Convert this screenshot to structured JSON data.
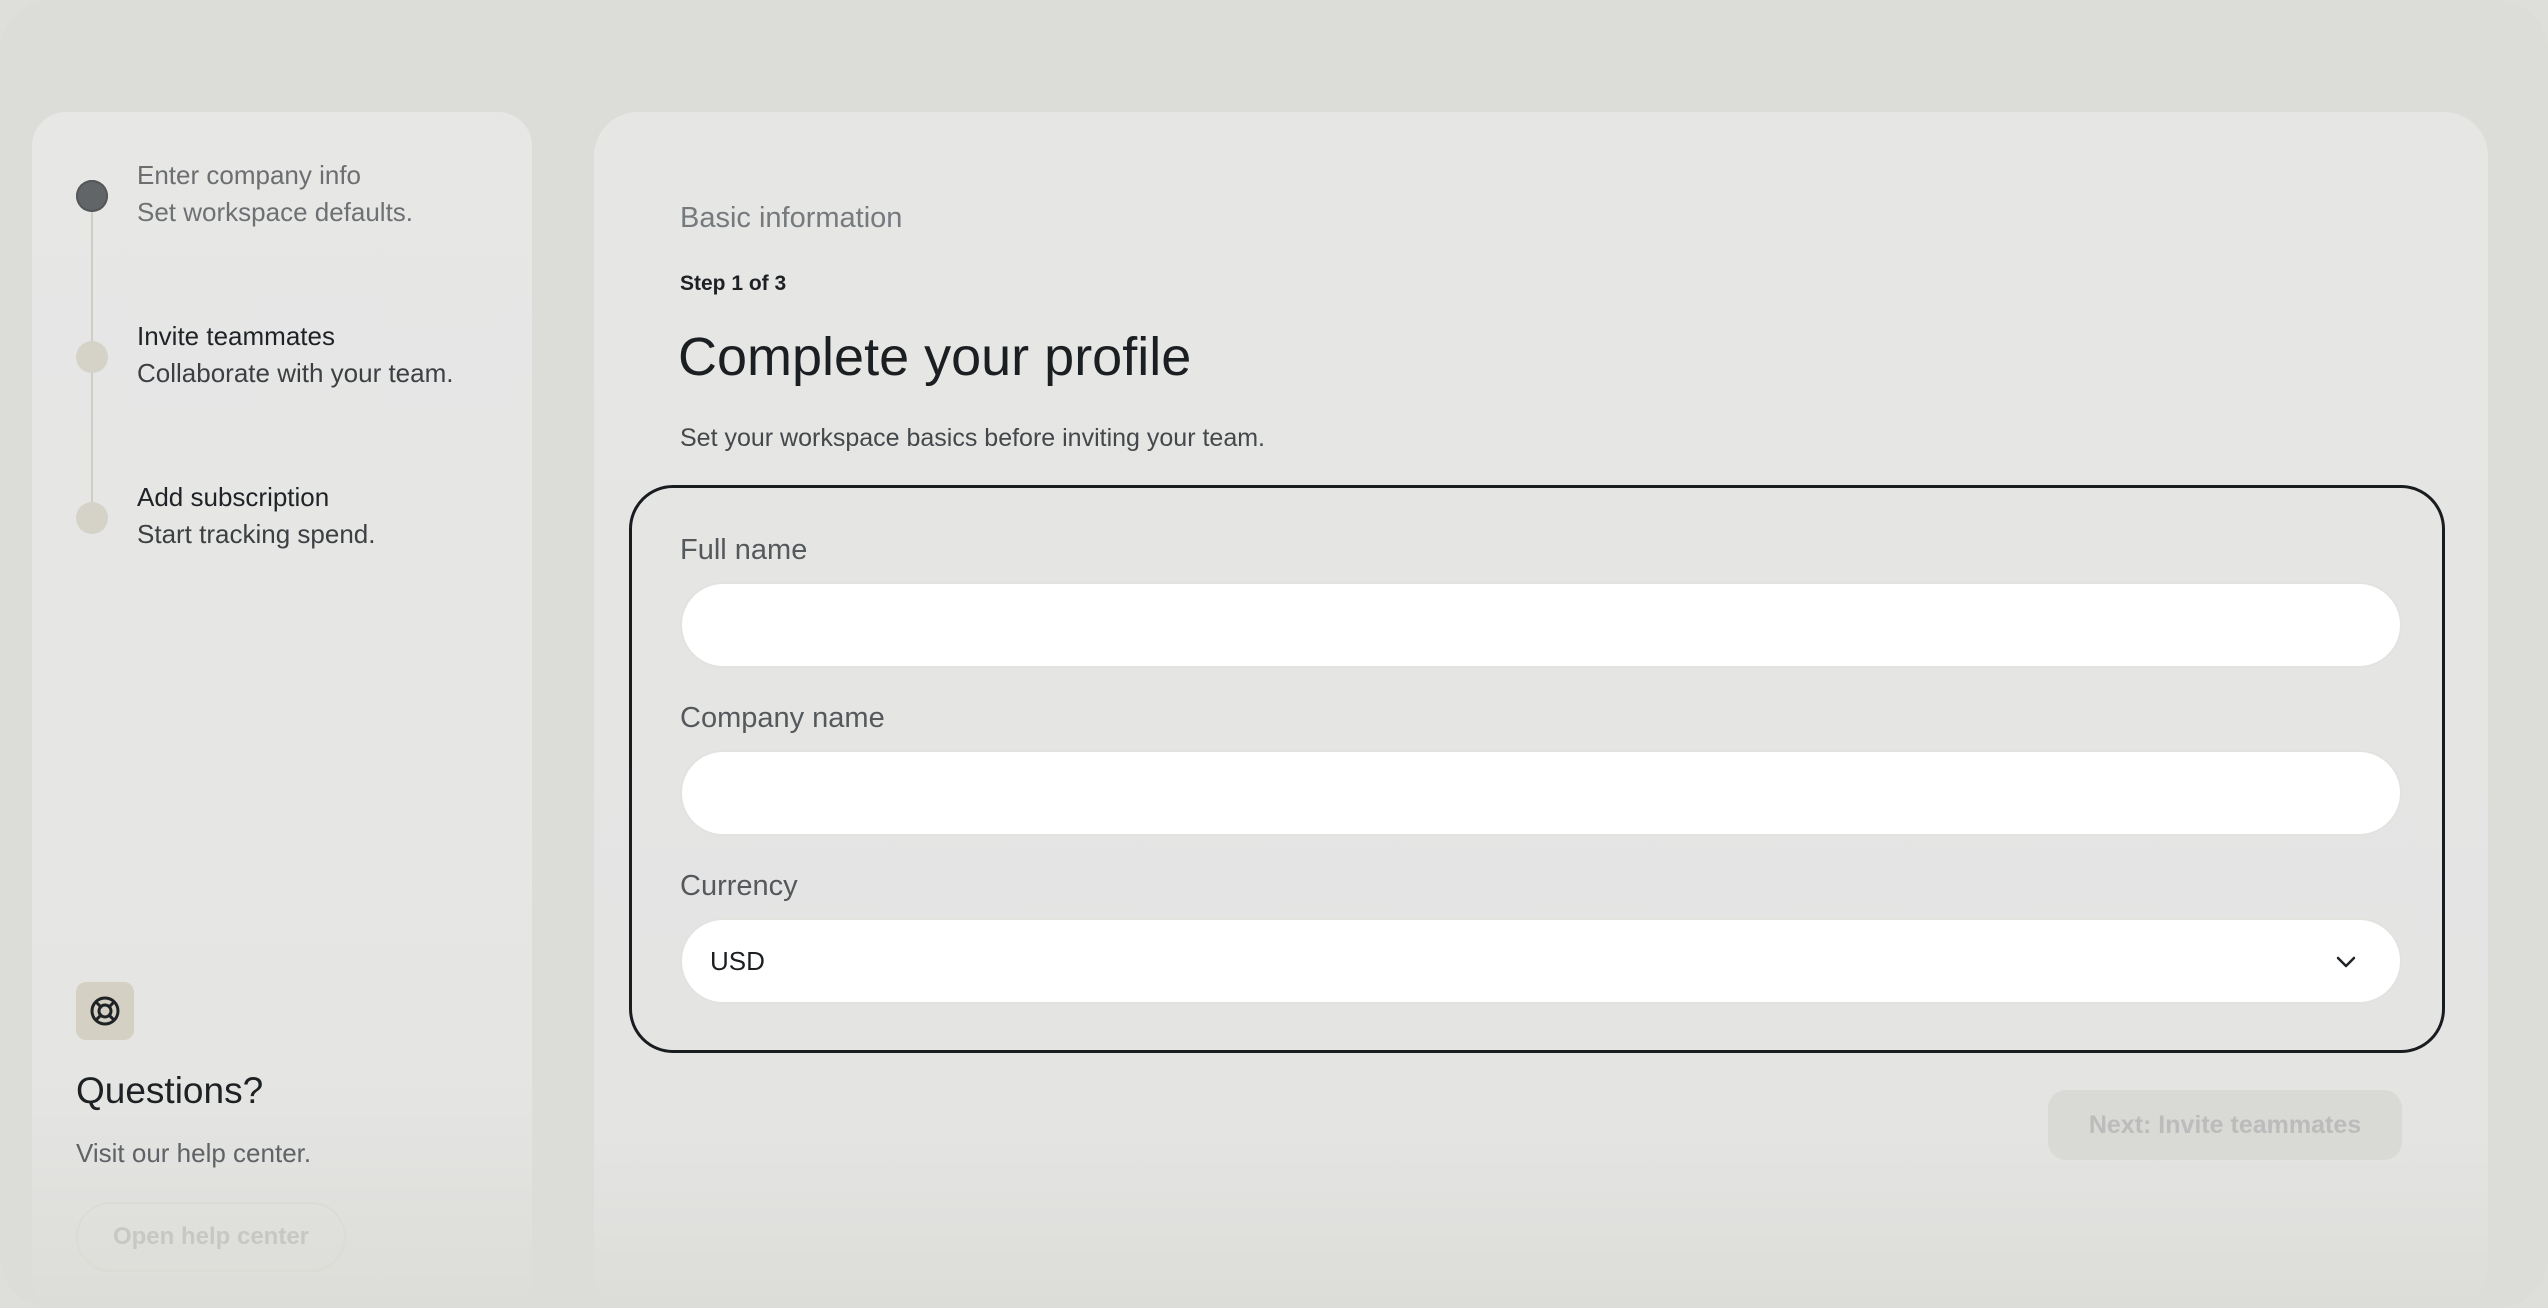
{
  "steps": [
    {
      "title": "Enter company info",
      "subtitle": "Set workspace defaults.",
      "state": "current"
    },
    {
      "title": "Invite teammates",
      "subtitle": "Collaborate with your team.",
      "state": "upcoming"
    },
    {
      "title": "Add subscription",
      "subtitle": "Start tracking spend.",
      "state": "upcoming"
    }
  ],
  "help": {
    "icon": "lifebuoy-icon",
    "title": "Questions?",
    "subtitle": "Visit our help center.",
    "button_label": "Open help center"
  },
  "main": {
    "section_label": "Basic information",
    "step_counter": "Step 1 of 3",
    "title": "Complete your profile",
    "subtitle": "Set your workspace basics before inviting your team."
  },
  "form": {
    "full_name": {
      "label": "Full name",
      "value": "",
      "placeholder": ""
    },
    "company_name": {
      "label": "Company name",
      "value": "",
      "placeholder": ""
    },
    "currency": {
      "label": "Currency",
      "selected": "USD"
    }
  },
  "actions": {
    "next_label": "Next: Invite teammates"
  },
  "colors": {
    "background": "#dcdcd8",
    "panel": "#e6e6e5",
    "active_step": "#626568",
    "inactive_step": "#d5d2c8",
    "focus_border": "#1a1d1f"
  }
}
